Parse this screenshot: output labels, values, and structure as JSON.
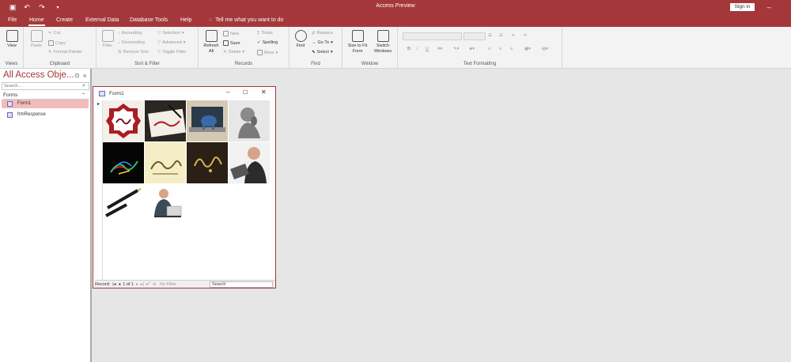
{
  "app": {
    "window_title": "Access Preview",
    "signin_label": "Sign in"
  },
  "menu": {
    "items": [
      "File",
      "Home",
      "Create",
      "External Data",
      "Database Tools",
      "Help"
    ],
    "active": "Home",
    "tell_me": "Tell me what you want to do"
  },
  "ribbon": {
    "views": {
      "label": "Views",
      "view": "View"
    },
    "clipboard": {
      "label": "Clipboard",
      "paste": "Paste",
      "cut": "Cut",
      "copy": "Copy",
      "format_painter": "Format Painter"
    },
    "sort_filter": {
      "label": "Sort & Filter",
      "filter": "Filter",
      "ascending": "Ascending",
      "descending": "Descending",
      "remove_sort": "Remove Sort",
      "selection": "Selection",
      "advanced": "Advanced",
      "toggle_filter": "Toggle Filter"
    },
    "records": {
      "label": "Records",
      "refresh_all": "Refresh All",
      "new": "New",
      "save": "Save",
      "delete": "Delete",
      "totals": "Totals",
      "spelling": "Spelling",
      "more": "More"
    },
    "find": {
      "label": "Find",
      "find": "Find",
      "replace": "Replace",
      "go_to": "Go To",
      "select": "Select"
    },
    "window": {
      "label": "Window",
      "size_to_fit": "Size to Fit Form",
      "switch_windows": "Switch Windows"
    },
    "text_formatting": {
      "label": "Text Formatting",
      "bold": "B",
      "italic": "I",
      "underline": "U"
    }
  },
  "nav": {
    "title": "All Access Obje...",
    "search_placeholder": "Search...",
    "section": "Forms",
    "items": [
      {
        "label": "Form1",
        "selected": true
      },
      {
        "label": "frmResponse",
        "selected": false
      }
    ]
  },
  "form": {
    "title": "Form1",
    "images": [
      {
        "subject": "arabic-calligraphy-red-octagon"
      },
      {
        "subject": "calligraphy-on-paper-with-pen"
      },
      {
        "subject": "laptop-with-elephant-figure"
      },
      {
        "subject": "thinking-statue"
      },
      {
        "subject": "colorful-calligraphy-on-black"
      },
      {
        "subject": "calligraphy-on-cream-paper"
      },
      {
        "subject": "golden-calligraphy-on-dark"
      },
      {
        "subject": "man-looking-at-laptop"
      },
      {
        "subject": "fountain-pen"
      },
      {
        "subject": "businessman-with-laptop"
      }
    ],
    "recnav": {
      "record_label": "Record:",
      "position": "1 of 1",
      "filter_label": "No Filter",
      "search_placeholder": "Search"
    }
  },
  "colors": {
    "accent": "#a4373a",
    "ribbon_bg": "#f3f3f3",
    "workspace": "#e6e6e6",
    "nav_selected": "#f2bcbc"
  }
}
